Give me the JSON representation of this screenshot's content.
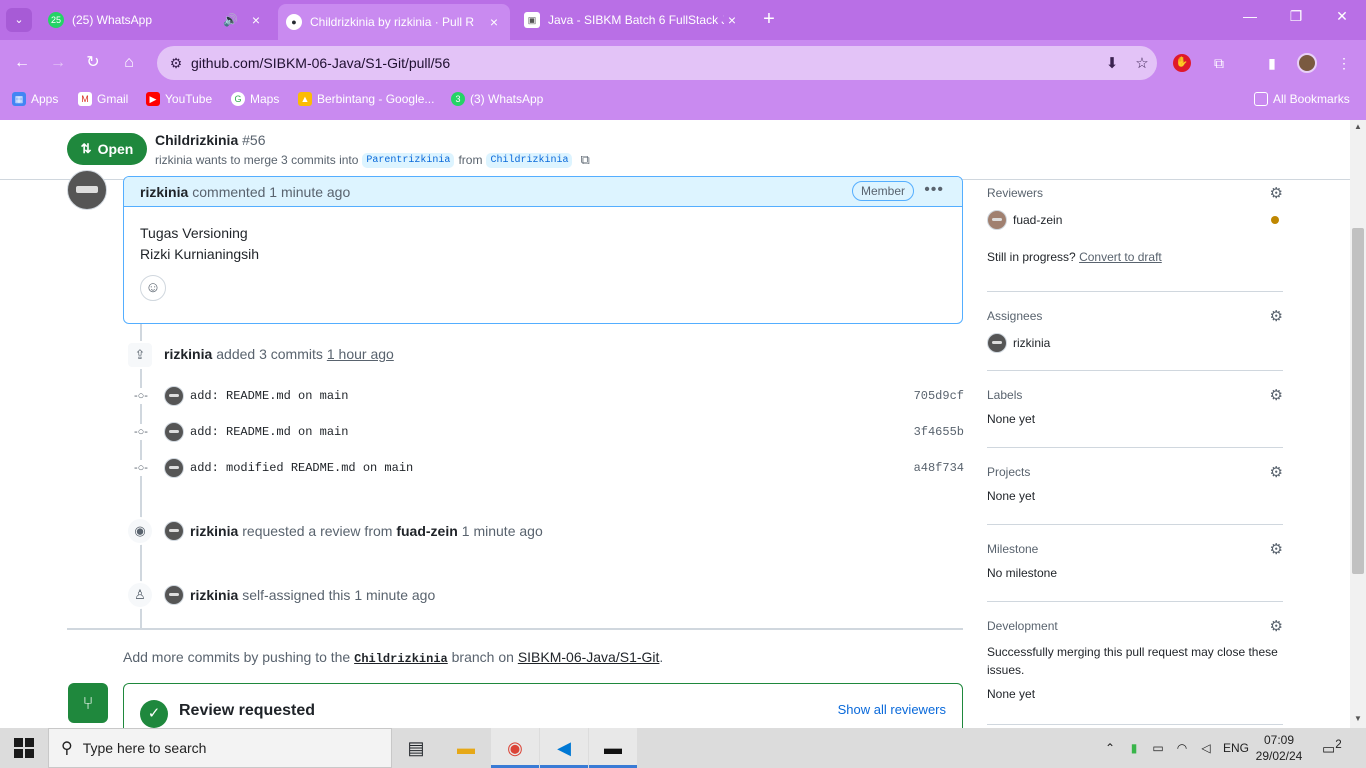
{
  "browser": {
    "tabs": [
      {
        "title": "(25) WhatsApp",
        "favicon": "whatsapp-icon",
        "badge": "25"
      },
      {
        "title": "Childrizkinia by rizkinia · Pull R",
        "favicon": "github-icon"
      },
      {
        "title": "Java - SIBKM Batch 6 FullStack J",
        "favicon": "classroom-icon"
      }
    ],
    "url": "github.com/SIBKM-06-Java/S1-Git/pull/56",
    "bookmarks": [
      {
        "label": "Apps"
      },
      {
        "label": "Gmail"
      },
      {
        "label": "YouTube"
      },
      {
        "label": "Maps"
      },
      {
        "label": "Berbintang - Google..."
      },
      {
        "label": "(3) WhatsApp",
        "badge": "3"
      }
    ],
    "all_bookmarks": "All Bookmarks"
  },
  "pr": {
    "state": "Open",
    "title": "Childrizkinia",
    "number": "#56",
    "author": "rizkinia",
    "merge_text": "wants to merge 3 commits into",
    "base_branch": "Parentrizkinia",
    "from_text": "from",
    "head_branch": "Childrizkinia"
  },
  "comment": {
    "author": "rizkinia",
    "action": "commented",
    "time": "1 minute ago",
    "role": "Member",
    "lines": [
      "Tugas Versioning",
      "Rizki Kurnianingsih"
    ]
  },
  "timeline": {
    "commits_event": {
      "author": "rizkinia",
      "action": "added 3 commits",
      "time": "1 hour ago"
    },
    "commits": [
      {
        "message": "add: README.md on main",
        "sha": "705d9cf"
      },
      {
        "message": "add: README.md on main",
        "sha": "3f4655b"
      },
      {
        "message": "add: modified README.md on main",
        "sha": "a48f734"
      }
    ],
    "review_event": {
      "author": "rizkinia",
      "action": "requested a review from",
      "reviewer": "fuad-zein",
      "time": "1 minute ago"
    },
    "assign_event": {
      "author": "rizkinia",
      "action": "self-assigned this",
      "time": "1 minute ago"
    }
  },
  "add_more": {
    "prefix": "Add more commits by pushing to the",
    "branch": "Childrizkinia",
    "middle": "branch on",
    "repo": "SIBKM-06-Java/S1-Git",
    "suffix": "."
  },
  "review_box": {
    "title": "Review requested",
    "link": "Show all reviewers"
  },
  "sidebar": {
    "reviewers": {
      "label": "Reviewers",
      "value": "fuad-zein",
      "draft_prompt": "Still in progress?",
      "draft_link": "Convert to draft"
    },
    "assignees": {
      "label": "Assignees",
      "value": "rizkinia"
    },
    "labels": {
      "label": "Labels",
      "value": "None yet"
    },
    "projects": {
      "label": "Projects",
      "value": "None yet"
    },
    "milestone": {
      "label": "Milestone",
      "value": "No milestone"
    },
    "development": {
      "label": "Development",
      "desc": "Successfully merging this pull request may close these issues.",
      "value": "None yet"
    }
  },
  "taskbar": {
    "search_placeholder": "Type here to search",
    "language": "ENG",
    "time": "07:09",
    "date": "29/02/24",
    "notifications": "2"
  },
  "colors": {
    "chrome_purple": "#c98af0",
    "open_green": "#1f883d",
    "link_blue": "#0969da",
    "comment_header_bg": "#ddf4ff"
  }
}
